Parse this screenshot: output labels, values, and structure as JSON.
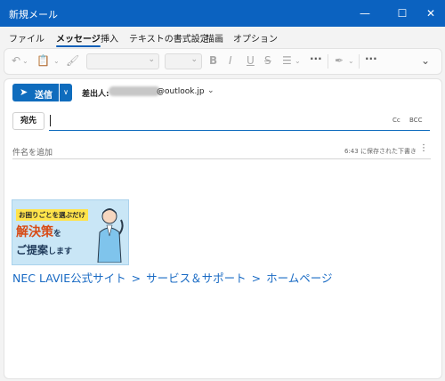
{
  "window": {
    "title": "新規メール",
    "minimize_icon": "minimize-icon",
    "maximize_icon": "maximize-icon",
    "close_icon": "close-icon"
  },
  "menu": {
    "items": [
      "ファイル",
      "メッセージ",
      "挿入",
      "テキストの書式設定",
      "描画",
      "オプション"
    ],
    "active": "メッセージ"
  },
  "ribbon": {
    "icons": [
      "undo-icon",
      "paste-icon",
      "format-painter-icon",
      "bold-icon",
      "italic-icon",
      "underline-icon",
      "strikethrough-icon",
      "line-spacing-icon",
      "more-icon",
      "highlight-icon",
      "more-icon",
      "expand-icon"
    ],
    "labels": {
      "bold": "B",
      "italic": "I",
      "underline": "U",
      "strike": "S",
      "more": "···"
    }
  },
  "compose": {
    "send_label": "送信",
    "from_label": "差出人:",
    "from_domain": "@outlook.jp",
    "to_label": "宛先",
    "cc_label": "Cc",
    "bcc_label": "BCC",
    "subject_placeholder": "件名を追加",
    "saved_status": "6:43 に保存された下書き"
  },
  "body": {
    "banner": {
      "line1": "お困りごとを選ぶだけ",
      "line2_main": "解決策",
      "line2_small": "を",
      "line3_main": "ご提案",
      "line3_small": "します"
    },
    "link": {
      "part1": "NEC LAVIE公式サイト",
      "sep1": ">",
      "part2": "サービス＆サポート",
      "sep2": ">",
      "part3": "ホームページ"
    }
  },
  "colors": {
    "accent": "#0f6cbd",
    "titlebar": "#0b62c0",
    "link": "#1a6bc4"
  }
}
